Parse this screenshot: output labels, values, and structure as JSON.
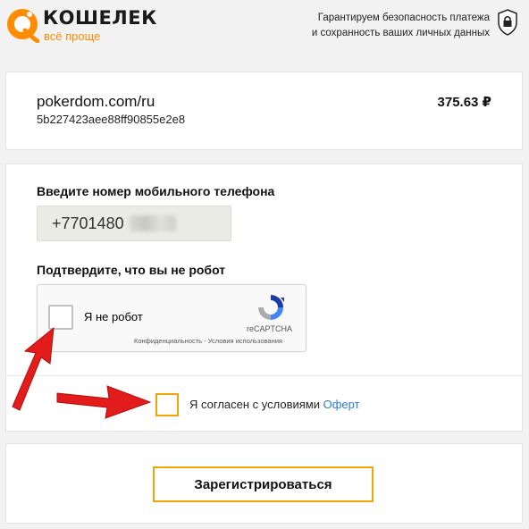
{
  "header": {
    "logo_title": "КОШЕЛЕК",
    "logo_tagline": "всё проще",
    "guarantee_line1": "Гарантируем безопасность платежа",
    "guarantee_line2": "и сохранность ваших личных данных",
    "lock_icon": "shield-lock-icon"
  },
  "merchant": {
    "name": "pokerdom.com/ru",
    "order_id": "5b227423aee88ff90855e2e8",
    "amount": "375.63 ₽"
  },
  "form": {
    "phone_label": "Введите номер мобильного телефона",
    "phone_value": "+7701480",
    "robot_label": "Подтвердите, что вы не робот",
    "recaptcha": {
      "checkbox_label": "Я не робот",
      "brand": "reCAPTCHA",
      "links": "Конфиденциальность - Условия использования"
    },
    "agree_text": "Я согласен с условиями ",
    "agree_link": "Оферт"
  },
  "submit": {
    "label": "Зарегистрироваться"
  },
  "colors": {
    "accent": "#f0a30a",
    "arrow": "#e21b1b",
    "link": "#2b7bd6",
    "logo_orange": "#ff8c00"
  }
}
